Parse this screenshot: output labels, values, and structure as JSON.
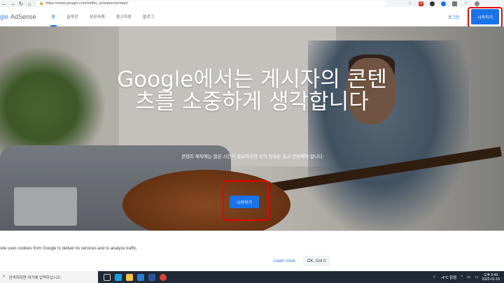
{
  "browser": {
    "url": "https://www.google.com/intl/ko_kr/adsense/start/",
    "back_icon": "arrow-left-icon",
    "forward_icon": "arrow-right-icon",
    "reload_icon": "reload-icon",
    "home_icon": "home-icon"
  },
  "header": {
    "logo_partial": "gle",
    "product": "AdSense",
    "nav": [
      "홈",
      "솔루션",
      "성공사례",
      "참고자료",
      "블로그"
    ],
    "login": "로그인",
    "start_button": "시작하기"
  },
  "hero": {
    "title": "Google에서는 게시자의 콘텐츠를 소중하게 생각합니다",
    "subtitle": "콘텐츠 제작에는 많은 시간이 필요하지만 수익 창출은 쉽고 간편해야 합니다",
    "cta": "시작하기"
  },
  "cookie": {
    "message": "site uses cookies from Google to deliver its services and to analyze traffic.",
    "learn_more": "Learn more",
    "ok": "OK, Got it"
  },
  "taskbar": {
    "search_placeholder": "검색하려면 여기에 입력하십시오.",
    "weather": "-4°C 맑음",
    "time": "오후 6:40",
    "date": "2022-01-16"
  },
  "colors": {
    "accent": "#1a73e8",
    "highlight": "#e00000"
  }
}
